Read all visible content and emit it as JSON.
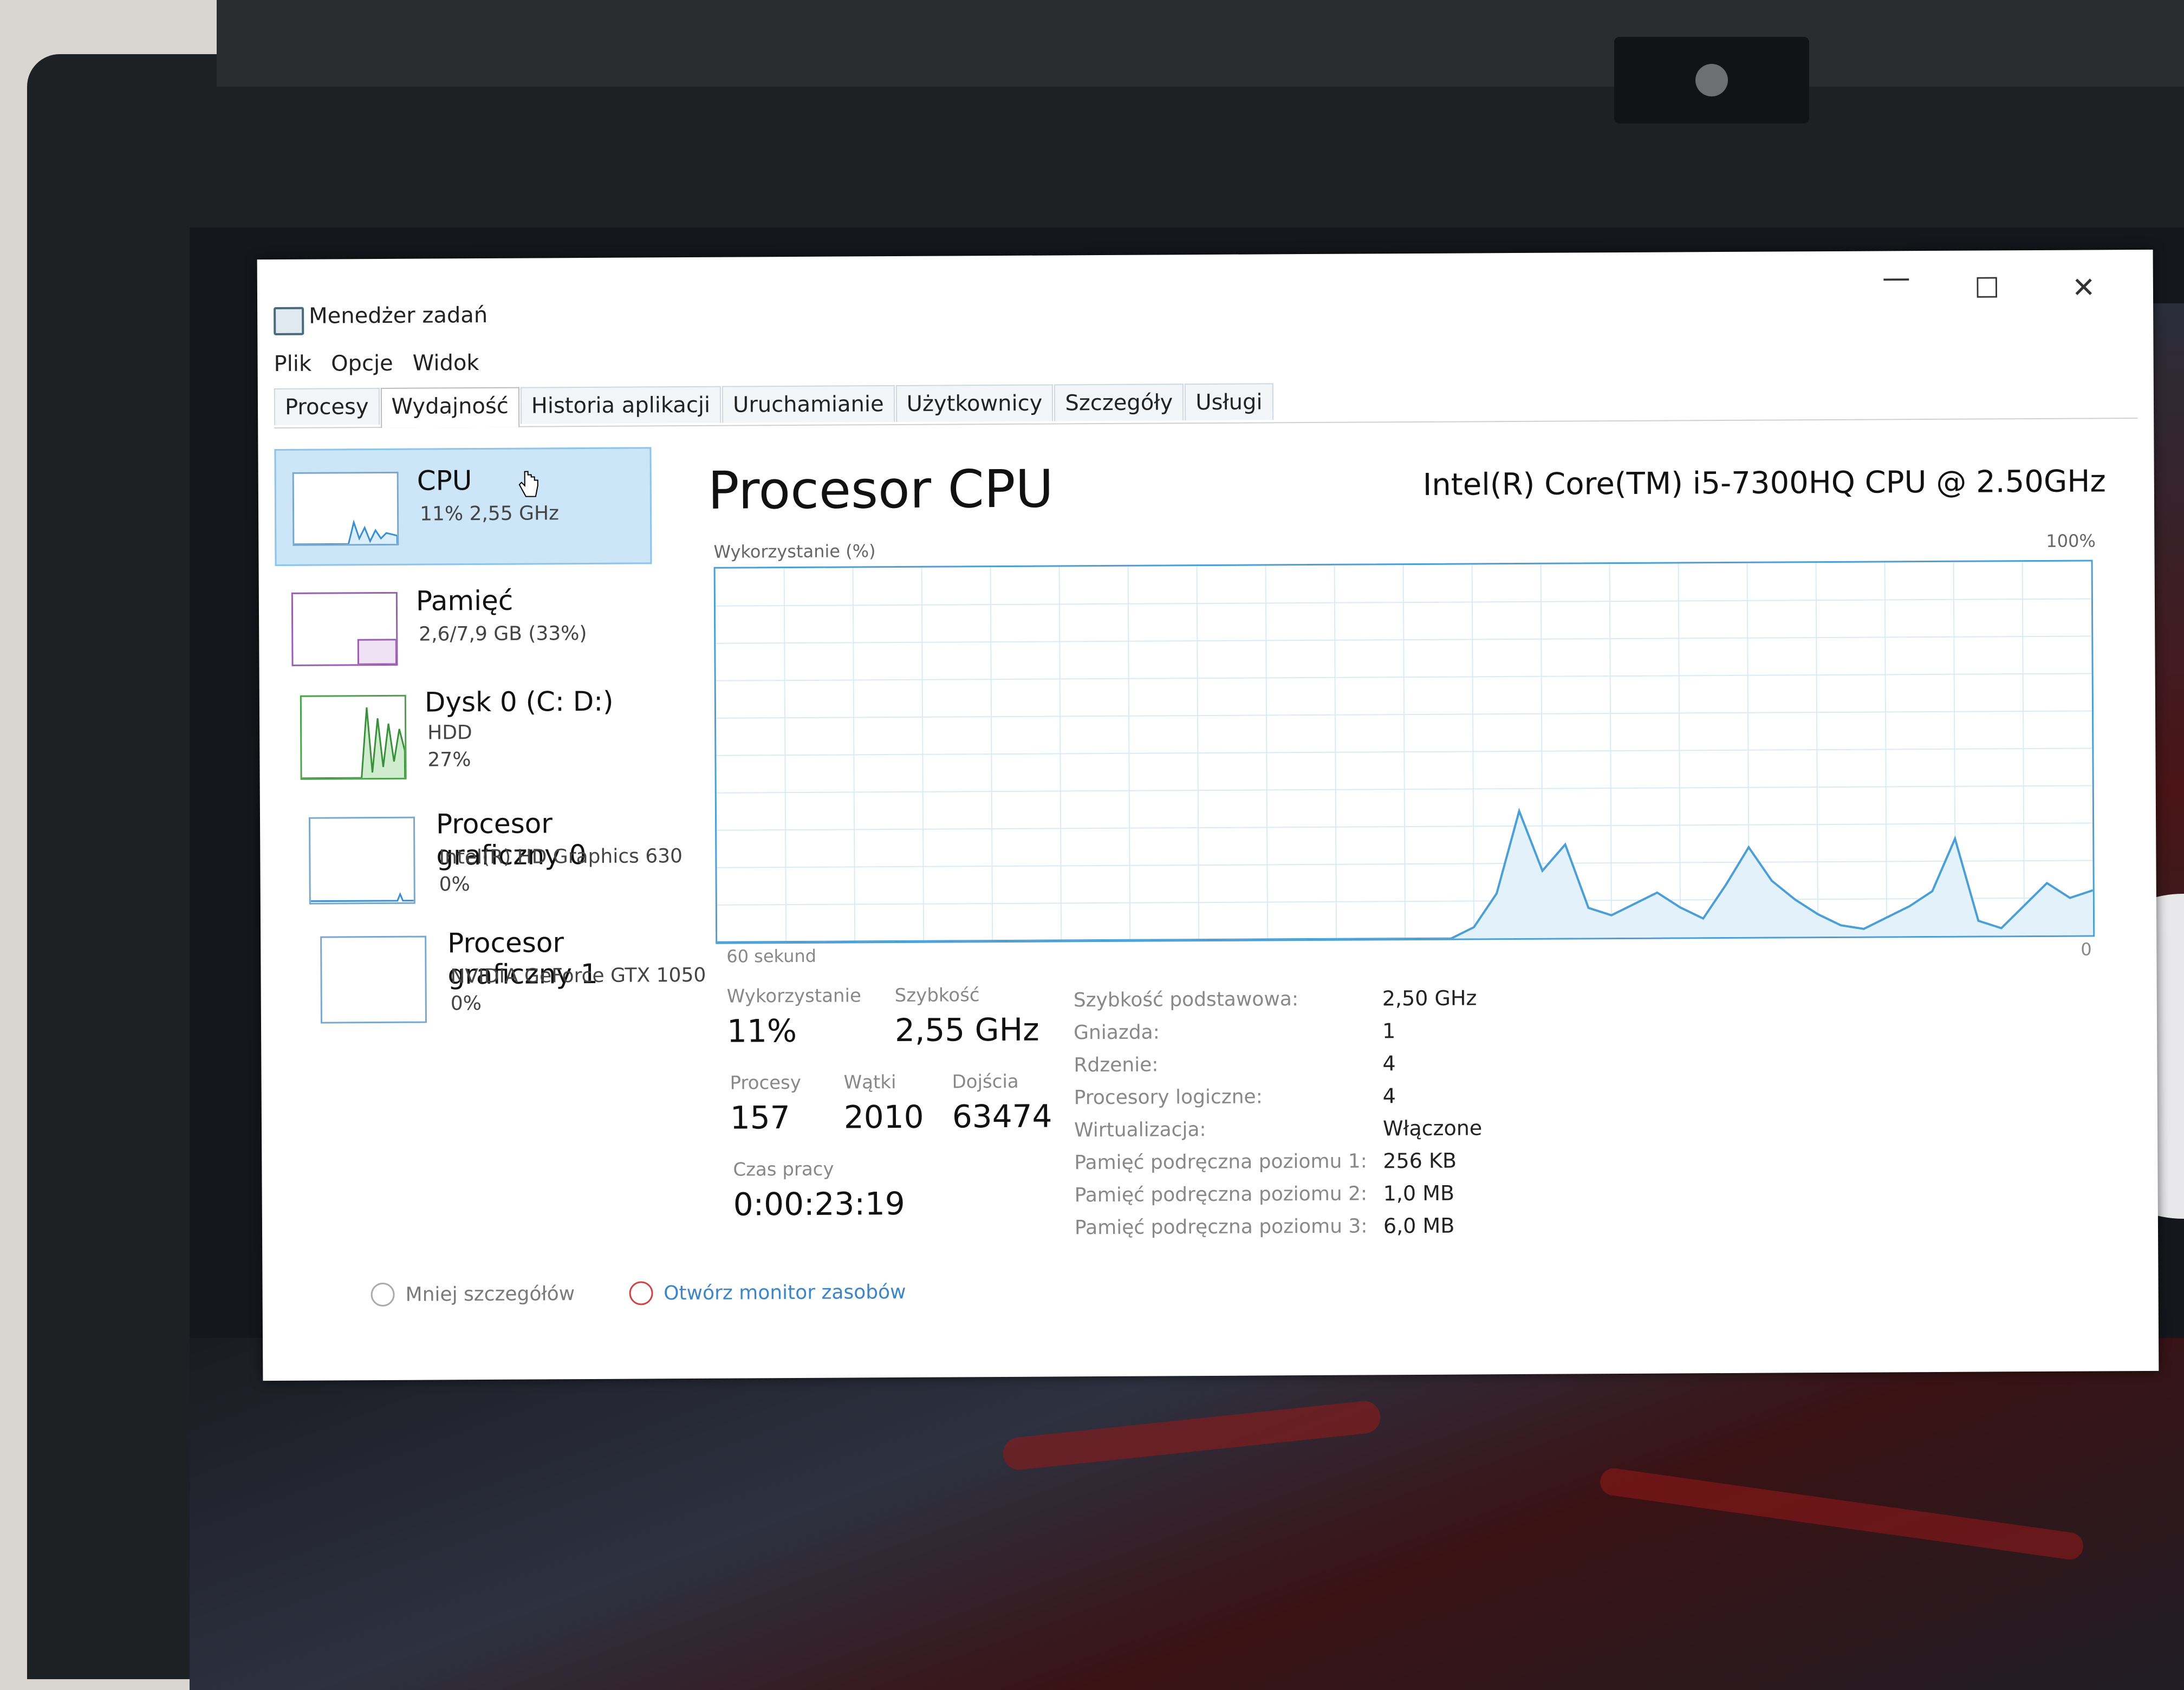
{
  "window": {
    "title": "Menedżer zadań"
  },
  "menu": [
    "Plik",
    "Opcje",
    "Widok"
  ],
  "tabs": [
    {
      "label": "Procesy",
      "active": false
    },
    {
      "label": "Wydajność",
      "active": true
    },
    {
      "label": "Historia aplikacji",
      "active": false
    },
    {
      "label": "Uruchamianie",
      "active": false
    },
    {
      "label": "Użytkownicy",
      "active": false
    },
    {
      "label": "Szczegóły",
      "active": false
    },
    {
      "label": "Usługi",
      "active": false
    }
  ],
  "sidebar": {
    "items": [
      {
        "title": "CPU",
        "sub": "11% 2,55 GHz",
        "sub2": ""
      },
      {
        "title": "Pamięć",
        "sub": "2,6/7,9 GB (33%)",
        "sub2": ""
      },
      {
        "title": "Dysk 0 (C: D:)",
        "sub": "HDD",
        "sub2": "27%"
      },
      {
        "title": "Procesor graficzny 0",
        "sub": "Intel(R) HD Graphics 630",
        "sub2": "0%"
      },
      {
        "title": "Procesor graficzny 1",
        "sub": "NVIDIA GeForce GTX 1050",
        "sub2": "0%"
      }
    ]
  },
  "main": {
    "title": "Procesor CPU",
    "cpu_model": "Intel(R) Core(TM) i5-7300HQ CPU @ 2.50GHz",
    "graph_label": "Wykorzystanie (%)",
    "graph_max": "100%",
    "graph_xlabel": "60 sekund",
    "graph_min": "0"
  },
  "chart_data": {
    "type": "area",
    "x": [
      0,
      2,
      4,
      6,
      8,
      10,
      12,
      14,
      16,
      18,
      20,
      22,
      24,
      26,
      28,
      30,
      32,
      33,
      34,
      35,
      36,
      37,
      38,
      39,
      40,
      41,
      42,
      43,
      44,
      45,
      46,
      47,
      48,
      49,
      50,
      51,
      52,
      53,
      54,
      55,
      56,
      57,
      58,
      59,
      60
    ],
    "values": [
      0,
      0,
      0,
      0,
      0,
      0,
      0,
      0,
      0,
      0,
      0,
      0,
      0,
      0,
      0,
      0,
      0,
      3,
      12,
      34,
      18,
      25,
      8,
      6,
      9,
      12,
      8,
      5,
      14,
      24,
      15,
      10,
      6,
      3,
      2,
      5,
      8,
      12,
      26,
      4,
      2,
      8,
      14,
      10,
      12
    ],
    "ylim": [
      0,
      100
    ],
    "color": "#4a9fd6"
  },
  "stats": {
    "usage": {
      "label": "Wykorzystanie",
      "value": "11%"
    },
    "speed": {
      "label": "Szybkość",
      "value": "2,55 GHz"
    },
    "processes": {
      "label": "Procesy",
      "value": "157"
    },
    "threads": {
      "label": "Wątki",
      "value": "2010"
    },
    "handles": {
      "label": "Dojścia",
      "value": "63474"
    },
    "uptime": {
      "label": "Czas pracy",
      "value": "0:00:23:19"
    }
  },
  "info": [
    {
      "label": "Szybkość podstawowa:",
      "value": "2,50 GHz"
    },
    {
      "label": "Gniazda:",
      "value": "1"
    },
    {
      "label": "Rdzenie:",
      "value": "4"
    },
    {
      "label": "Procesory logiczne:",
      "value": "4"
    },
    {
      "label": "Wirtualizacja:",
      "value": "Włączone"
    },
    {
      "label": "Pamięć podręczna poziomu 1:",
      "value": "256 KB"
    },
    {
      "label": "Pamięć podręczna poziomu 2:",
      "value": "1,0 MB"
    },
    {
      "label": "Pamięć podręczna poziomu 3:",
      "value": "6,0 MB"
    }
  ],
  "footer": {
    "fewer": "Mniej szczegółów",
    "monitor": "Otwórz monitor zasobów"
  }
}
